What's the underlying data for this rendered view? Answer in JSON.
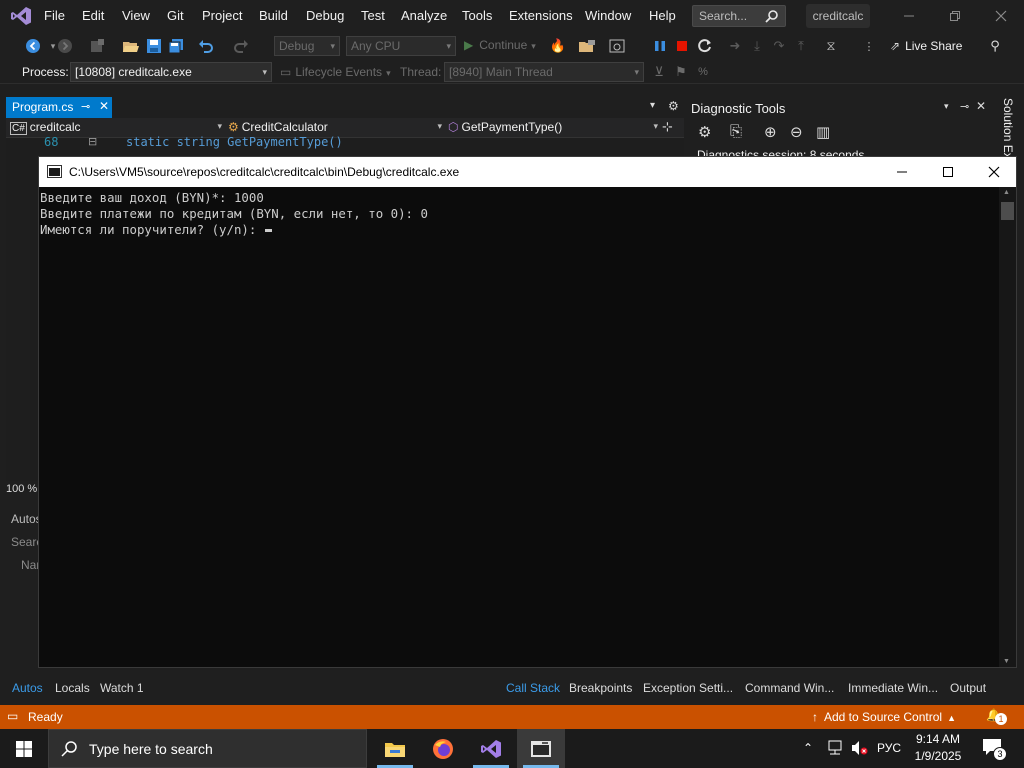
{
  "menu": {
    "items": [
      "File",
      "Edit",
      "View",
      "Git",
      "Project",
      "Build",
      "Debug",
      "Test",
      "Analyze",
      "Tools",
      "Extensions",
      "Window",
      "Help"
    ],
    "search_placeholder": "Search...",
    "app_title": "creditcalc"
  },
  "toolbar": {
    "configuration": "Debug",
    "platform": "Any CPU",
    "continue_label": "Continue",
    "live_share_label": "Live Share"
  },
  "debug_location": {
    "process_label": "Process:",
    "process_value": "[10808] creditcalc.exe",
    "lifecycle_label": "Lifecycle Events",
    "thread_label": "Thread:",
    "thread_value": "[8940] Main Thread"
  },
  "editor": {
    "tab_label": "Program.cs",
    "nav_project": "creditcalc",
    "nav_class": "CreditCalculator",
    "nav_member": "GetPaymentType()",
    "line_number": "68",
    "code_line": "static string GetPaymentType()",
    "zoom": "100 %"
  },
  "left_pane": {
    "title": "Autos",
    "search": "Searc",
    "column": "Nar"
  },
  "diagnostic_tools": {
    "title": "Diagnostic Tools",
    "session_text": "Diagnostics session: 8 seconds"
  },
  "solution_explorer_tab": "Solution Ex",
  "console": {
    "title": "C:\\Users\\VM5\\source\\repos\\creditcalc\\creditcalc\\bin\\Debug\\creditcalc.exe",
    "lines": [
      "Введите ваш доход (BYN)*: 1000",
      "Введите платежи по кредитам (BYN, если нет, то 0): 0",
      "Имеются ли поручители? (y/n): "
    ]
  },
  "bottom_tabs_left": [
    "Autos",
    "Locals",
    "Watch 1"
  ],
  "bottom_tabs_right": [
    "Call Stack",
    "Breakpoints",
    "Exception Setti...",
    "Command Win...",
    "Immediate Win...",
    "Output"
  ],
  "status": {
    "ready": "Ready",
    "source_control": "Add to Source Control",
    "notifications": "1"
  },
  "taskbar": {
    "search_placeholder": "Type here to search",
    "language": "РУС",
    "time": "9:14 AM",
    "date": "1/9/2025",
    "notification_count": "3"
  },
  "colors": {
    "accent": "#007acc",
    "status_bar": "#ca5100",
    "console_bg": "#0c0c0c"
  }
}
